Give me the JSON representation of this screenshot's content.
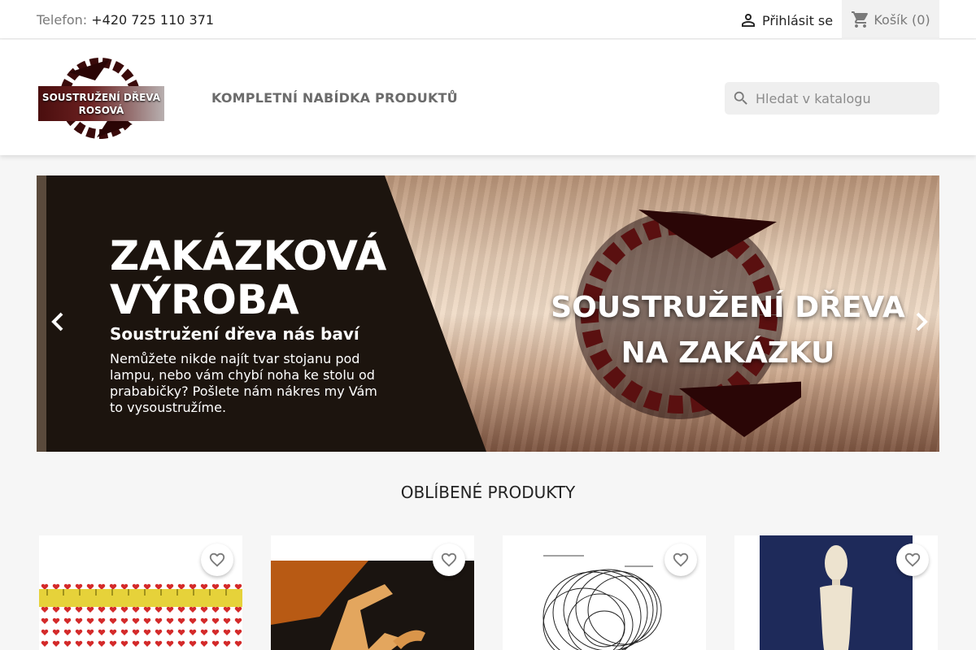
{
  "topbar": {
    "phone_label": "Telefon:",
    "phone_number": "+420 725 110 371",
    "signin_label": "Přihlásit se",
    "cart_label": "Košík",
    "cart_count": "(0)"
  },
  "header": {
    "logo_line1": "SOUSTRUŽENÍ DŘEVA",
    "logo_line2": "ROSOVÁ",
    "nav_all_products": "KOMPLETNÍ NABÍDKA PRODUKTŮ",
    "search_placeholder": "Hledat v katalogu"
  },
  "slider": {
    "title": "ZAKÁZKOVÁ VÝROBA",
    "subtitle": "Soustružení dřeva nás baví",
    "text": "Nemůžete nikde najít tvar stojanu pod lampu, nebo vám chybí noha ke stolu od prababičky? Pošlete nám nákres my Vám to vysoustružíme.",
    "overlay_line1": "SOUSTRUŽENÍ DŘEVA",
    "overlay_line2": "NA ZAKÁZKU"
  },
  "products": {
    "section_title": "OBLÍBENÉ PRODUKTY"
  },
  "colors": {
    "accent_brown": "#4a0e0e",
    "background": "#f6f6f6"
  },
  "icons": {
    "signin": "person-icon",
    "cart": "shopping-cart-icon",
    "search": "search-icon",
    "prev": "chevron-left-icon",
    "next": "chevron-right-icon",
    "wishlist": "heart-outline-icon"
  }
}
